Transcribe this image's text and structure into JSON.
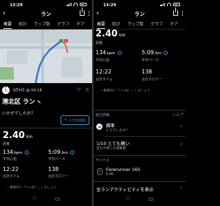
{
  "status": {
    "time": "13:29"
  },
  "header": {
    "title": "ラン",
    "back": "‹",
    "share": "share",
    "more": "more"
  },
  "tabs": [
    {
      "label": "概要",
      "active": true
    },
    {
      "label": "統計",
      "active": false
    },
    {
      "label": "ラップ数",
      "active": false
    },
    {
      "label": "グラフ",
      "active": false
    },
    {
      "label": "ギア",
      "active": false
    }
  ],
  "activity": {
    "datetime": "3月5日 @ 06:18",
    "title": "港北区 ラン",
    "question": "いかがでしたか？",
    "memo_button": "メモの追加",
    "distance_value": "2.40",
    "distance_unit": "km",
    "distance_label": "距離"
  },
  "stats": {
    "hr_value": "134",
    "hr_unit": "bpm",
    "hr_label": "平均心拍",
    "pace_value": "5:09",
    "pace_unit": "/km",
    "pace_label": "平均ペース",
    "time_value": "12:22",
    "time_label": "合計タイム",
    "cal_value": "138",
    "cal_label": "合計カロリー",
    "hint": "一番最初に「いいね！」しましょう"
  },
  "self_eval": {
    "section": "自己評価",
    "help": "ヘルプ",
    "feel_title": "標準",
    "feel_sub": "どうでしたか？",
    "effort_title": "1/10 とても軽い",
    "effort_sub": "自分が感じた運動量"
  },
  "device": {
    "section": "デバイス",
    "name": "Forerunner 165",
    "version": "6.08"
  },
  "all_activities": "全ランアクティビティを表示",
  "colors": {
    "accent": "#3b9fe0",
    "background": "#000000"
  }
}
